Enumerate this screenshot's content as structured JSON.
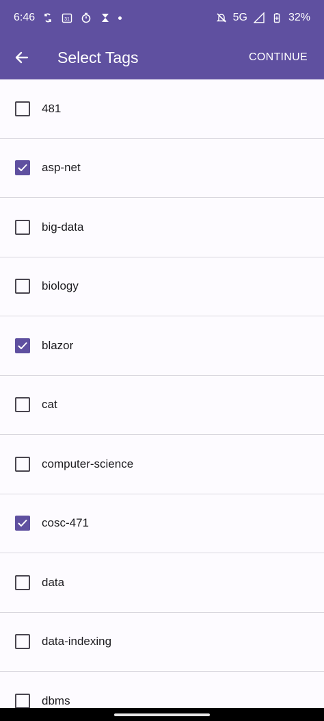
{
  "status_bar": {
    "time": "6:46",
    "left_icons": [
      "sync-icon",
      "calendar-icon",
      "timer-icon",
      "hourglass-icon"
    ],
    "calendar_day": "31",
    "network": "5G",
    "battery": "32%"
  },
  "app_bar": {
    "title": "Select Tags",
    "continue_label": "CONTINUE"
  },
  "tags": [
    {
      "label": "481",
      "checked": false
    },
    {
      "label": "asp-net",
      "checked": true
    },
    {
      "label": "big-data",
      "checked": false
    },
    {
      "label": "biology",
      "checked": false
    },
    {
      "label": "blazor",
      "checked": true
    },
    {
      "label": "cat",
      "checked": false
    },
    {
      "label": "computer-science",
      "checked": false
    },
    {
      "label": "cosc-471",
      "checked": true
    },
    {
      "label": "data",
      "checked": false
    },
    {
      "label": "data-indexing",
      "checked": false
    },
    {
      "label": "dbms",
      "checked": false
    }
  ],
  "colors": {
    "primary": "#5f50a0",
    "background": "#fdfbff",
    "divider": "#d9d7de"
  }
}
